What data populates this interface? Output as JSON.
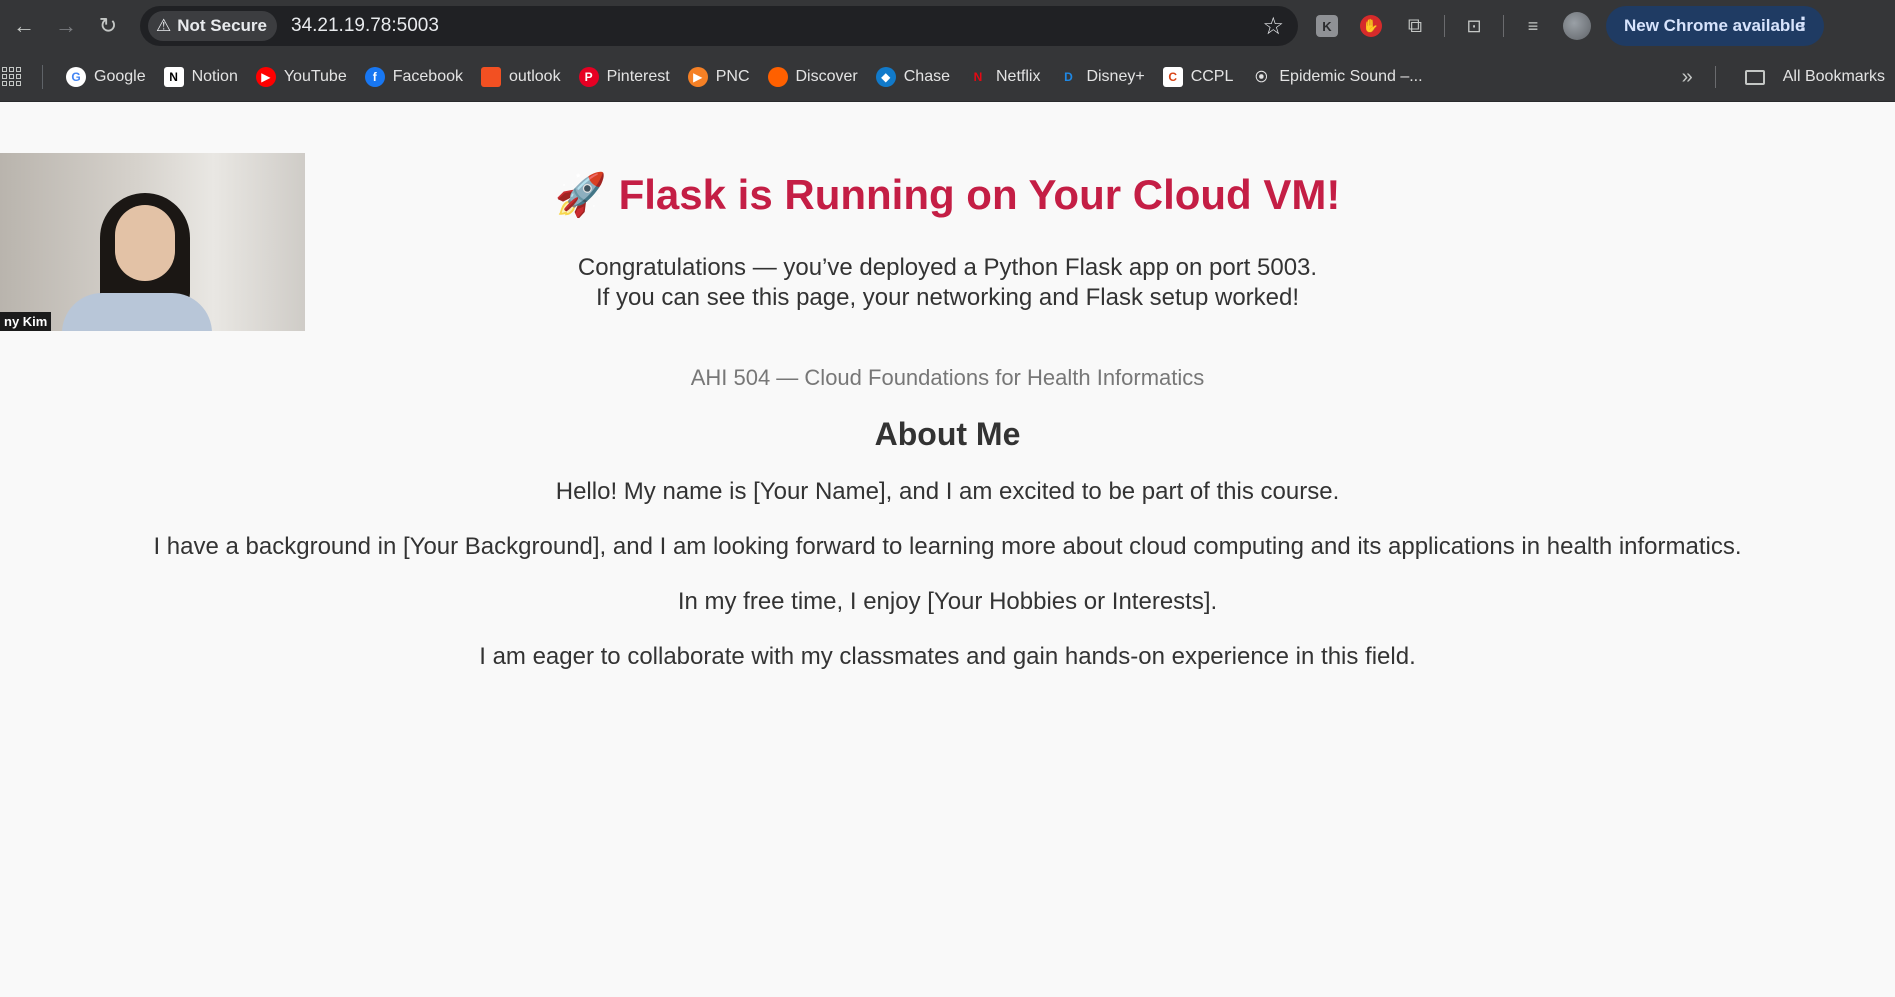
{
  "browser": {
    "security_label": "Not Secure",
    "url": "34.21.19.78:5003",
    "update_button_label": "New Chrome available",
    "extensions": [
      {
        "icon": "k-extension-icon",
        "text": "K"
      },
      {
        "icon": "hand-extension-icon",
        "text": "✋"
      }
    ]
  },
  "bookmarks": {
    "items": [
      {
        "label": "Google",
        "icon": "google-icon",
        "glyph": "G",
        "color": "#ffffff",
        "fg": "#4285f4"
      },
      {
        "label": "Notion",
        "icon": "notion-icon",
        "glyph": "N",
        "color": "#ffffff",
        "fg": "#000000"
      },
      {
        "label": "YouTube",
        "icon": "youtube-icon",
        "glyph": "▶",
        "color": "#ff0000",
        "fg": "#ffffff"
      },
      {
        "label": "Facebook",
        "icon": "facebook-icon",
        "glyph": "f",
        "color": "#1877f2",
        "fg": "#ffffff"
      },
      {
        "label": "outlook",
        "icon": "microsoft-icon",
        "glyph": "",
        "color": "#f25022",
        "fg": "#ffffff"
      },
      {
        "label": "Pinterest",
        "icon": "pinterest-icon",
        "glyph": "P",
        "color": "#e60023",
        "fg": "#ffffff"
      },
      {
        "label": "PNC",
        "icon": "pnc-icon",
        "glyph": "▶",
        "color": "#f58025",
        "fg": "#ffffff"
      },
      {
        "label": "Discover",
        "icon": "discover-icon",
        "glyph": "",
        "color": "#ff6000",
        "fg": "#ffffff"
      },
      {
        "label": "Chase",
        "icon": "chase-icon",
        "glyph": "◆",
        "color": "#117aca",
        "fg": "#ffffff"
      },
      {
        "label": "Netflix",
        "icon": "netflix-icon",
        "glyph": "N",
        "color": "#353638",
        "fg": "#e50914"
      },
      {
        "label": "Disney+",
        "icon": "disney-icon",
        "glyph": "D",
        "color": "#353638",
        "fg": "#1e88e5"
      },
      {
        "label": "CCPL",
        "icon": "ccpl-icon",
        "glyph": "C",
        "color": "#ffffff",
        "fg": "#d84315"
      },
      {
        "label": "Epidemic Sound –...",
        "icon": "epidemic-sound-icon",
        "glyph": "⦿",
        "color": "#353638",
        "fg": "#e3e3e3"
      }
    ],
    "all_bookmarks_label": "All Bookmarks"
  },
  "webcam": {
    "name_label": "ny Kim"
  },
  "page": {
    "title_emoji": "🚀",
    "title": "Flask is Running on Your Cloud VM!",
    "intro_line1": "Congratulations — you’ve deployed a Python Flask app on port 5003.",
    "intro_line2": "If you can see this page, your networking and Flask setup worked!",
    "course": "AHI 504 — Cloud Foundations for Health Informatics",
    "about_heading": "About Me",
    "paragraphs": [
      "Hello! My name is [Your Name], and I am excited to be part of this course.",
      "I have a background in [Your Background], and I am looking forward to learning more about cloud computing and its applications in health informatics.",
      "In my free time, I enjoy [Your Hobbies or Interests].",
      "I am eager to collaborate with my classmates and gain hands-on experience in this field."
    ]
  },
  "colors": {
    "title": "#c41e45",
    "toolbar": "#353638",
    "omnibox": "#202124",
    "update_button": "#1f3b63"
  }
}
